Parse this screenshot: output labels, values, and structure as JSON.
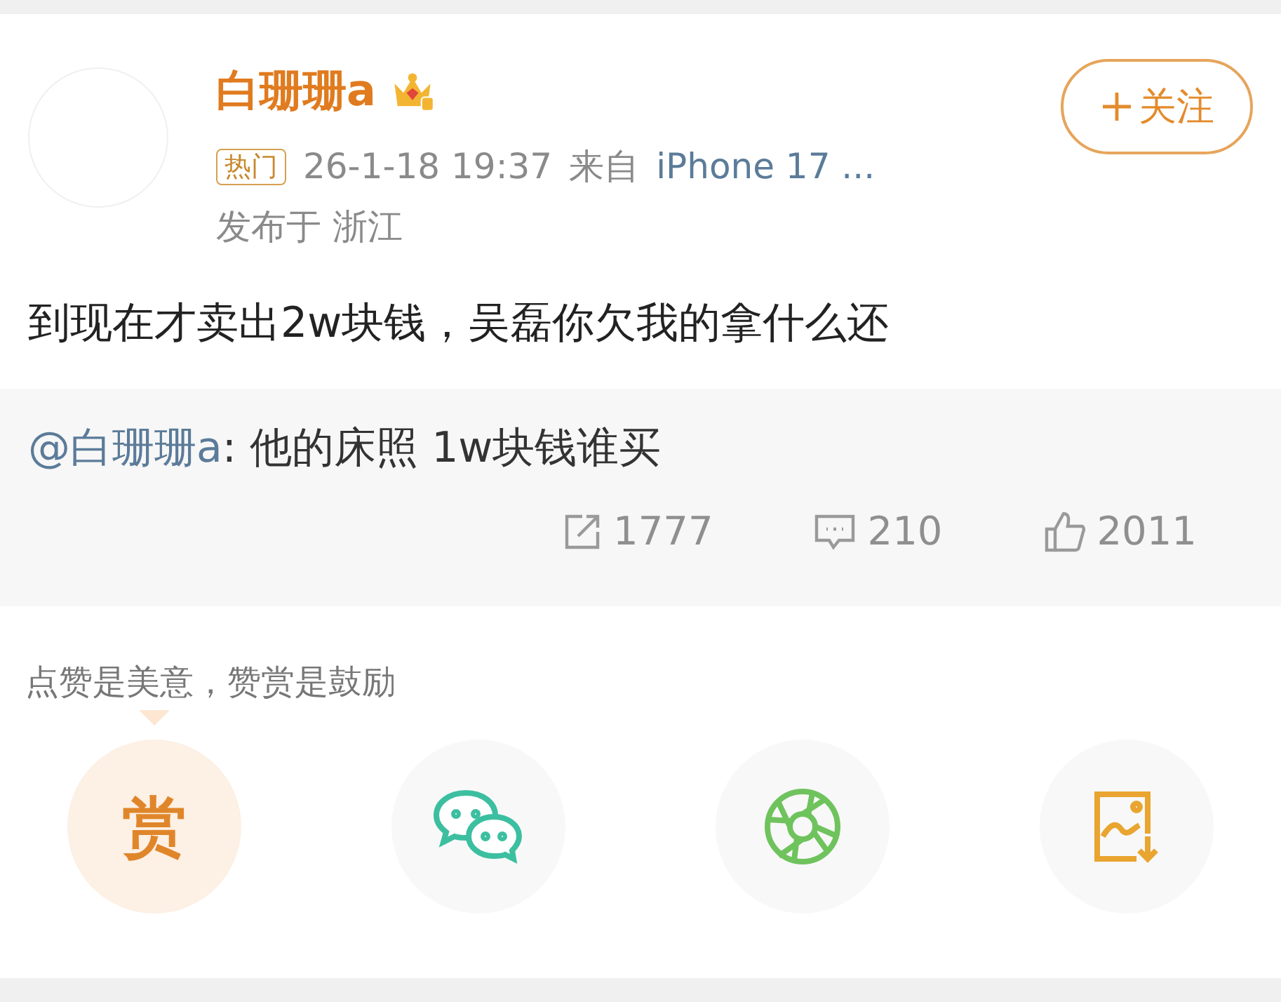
{
  "post": {
    "author": "白珊珊a",
    "follow_label": "关注",
    "badge": "热门",
    "time": "26-1-18 19:37",
    "source_prefix": "来自",
    "source": "iPhone 17 ...",
    "location": "发布于 浙江",
    "text": "到现在才卖出2w块钱，吴磊你欠我的拿什么还"
  },
  "retweet": {
    "mention": "@白珊珊a",
    "text": ": 他的床照 1w块钱谁买",
    "actions": [
      {
        "kind": "repost",
        "count": "1777"
      },
      {
        "kind": "comment",
        "count": "210"
      },
      {
        "kind": "like",
        "count": "2011"
      }
    ]
  },
  "reward": {
    "hint": "点赞是美意，赞赏是鼓励",
    "buttons": [
      {
        "kind": "reward",
        "label": "赏",
        "selected": true
      },
      {
        "kind": "wechat",
        "selected": false
      },
      {
        "kind": "moments",
        "selected": false
      },
      {
        "kind": "save_image",
        "selected": false
      }
    ]
  }
}
